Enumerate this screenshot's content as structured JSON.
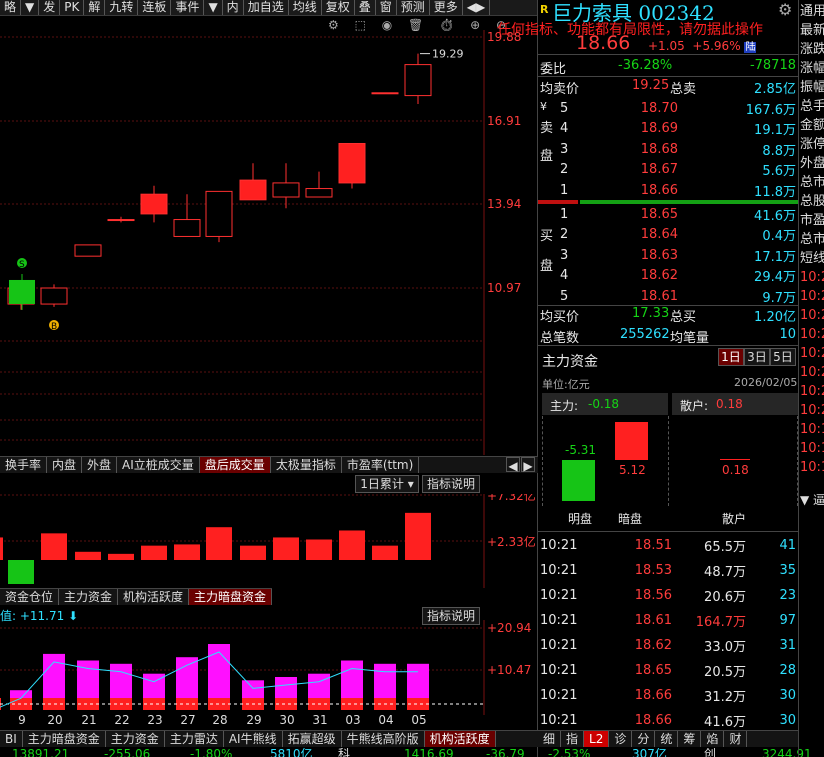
{
  "toolbar": {
    "items": [
      "略",
      "▼",
      "发",
      "PK",
      "解",
      "九转",
      "连板",
      "事件",
      "▼",
      "内",
      "加自选",
      "均线",
      "复权",
      "叠",
      "窗",
      "预测",
      "更多",
      "◀▶"
    ]
  },
  "chart_icons": "⚙ ⬚ ◉ 🗑 ⏱ ⊕ ⊖",
  "main_chart": {
    "price_labels": [
      "19.88",
      "16.91",
      "13.94",
      "10.97"
    ],
    "high_label": "19.29",
    "candles": [
      {
        "o": 10.97,
        "c": 10.4,
        "h": 11.2,
        "l": 10.2,
        "up": false
      },
      {
        "o": 10.4,
        "c": 10.97,
        "h": 11.1,
        "l": 10.3,
        "up": true
      },
      {
        "o": 12.1,
        "c": 12.5,
        "h": 12.5,
        "l": 12.1,
        "up": true
      },
      {
        "o": 13.4,
        "c": 13.4,
        "h": 13.5,
        "l": 13.3,
        "up": true
      },
      {
        "o": 13.6,
        "c": 14.3,
        "h": 14.6,
        "l": 13.3,
        "up": true
      },
      {
        "o": 12.8,
        "c": 13.4,
        "h": 14.3,
        "l": 12.8,
        "up": true
      },
      {
        "o": 12.8,
        "c": 14.4,
        "h": 14.4,
        "l": 12.6,
        "up": true
      },
      {
        "o": 14.1,
        "c": 14.8,
        "h": 15.4,
        "l": 14.1,
        "up": true
      },
      {
        "o": 14.2,
        "c": 14.7,
        "h": 15.4,
        "l": 13.8,
        "up": true
      },
      {
        "o": 14.2,
        "c": 14.5,
        "h": 15.1,
        "l": 14.2,
        "up": true
      },
      {
        "o": 14.7,
        "c": 16.1,
        "h": 16.1,
        "l": 14.5,
        "up": true
      },
      {
        "o": 17.9,
        "c": 17.9,
        "h": 17.9,
        "l": 17.9,
        "up": true
      },
      {
        "o": 17.8,
        "c": 18.9,
        "h": 19.29,
        "l": 17.5,
        "up": true
      }
    ],
    "markers": {
      "s": "S",
      "b": "B"
    }
  },
  "mid_tabs": [
    "换手率",
    "内盘",
    "外盘",
    "AI立桩成交量",
    "盘后成交量",
    "太极量指标",
    "市盈率(ttm)"
  ],
  "mid_select": "1日累计",
  "mid_help": "指标说明",
  "mid_axis": [
    "+7.32亿",
    "+2.33亿"
  ],
  "mid_bars": [
    0.55,
    0.3,
    0.65,
    0.2,
    0.15,
    0.35,
    0.38,
    0.8,
    0.35,
    0.55,
    0.5,
    0.72,
    0.35,
    1.15
  ],
  "low_tabs": [
    "资金仓位",
    "主力资金",
    "机构活跃度",
    "主力暗盘资金"
  ],
  "low_help": "指标说明",
  "low_value": "值: +11.71 ⬇",
  "low_axis": [
    "+20.94",
    "+10.47"
  ],
  "low_bars": [
    0.1,
    0.3,
    0.85,
    0.75,
    0.7,
    0.55,
    0.8,
    1.0,
    0.45,
    0.5,
    0.55,
    0.75,
    0.7,
    0.7
  ],
  "dates": [
    "9",
    "20",
    "21",
    "22",
    "23",
    "27",
    "28",
    "29",
    "30",
    "31",
    "03",
    "04",
    "05"
  ],
  "bottom_tabs": [
    "BI",
    "主力暗盘资金",
    "主力资金",
    "主力雷达",
    "AI牛熊线",
    "拓赢超级",
    "牛熊线高阶版",
    "机构活跃度"
  ],
  "bottom_ticker": [
    "13891.21",
    "-255.06",
    "-1.80%",
    "5810亿",
    "科",
    "1416.69",
    "-36.79",
    "-2.53%",
    "307亿",
    "创",
    "3244.91"
  ],
  "stock": {
    "name": "巨力索具",
    "code": "002342",
    "price": "18.66",
    "chg": "+1.05",
    "pct": "+5.96%",
    "tag": "陆"
  },
  "warning": "任何指标、功能都有局限性，请勿据此操作",
  "stats": {
    "weibi_label": "委比",
    "weibi": "-36.28%",
    "weicha": "-78718",
    "avg_sell_label": "均卖价",
    "avg_sell": "19.25",
    "total_sell_label": "总卖",
    "total_sell": "2.85亿",
    "avg_buy_label": "均买价",
    "avg_buy": "17.33",
    "total_buy_label": "总买",
    "total_buy": "1.20亿",
    "bills_label": "总笔数",
    "bills": "255262",
    "avg_vol_label": "均笔量",
    "avg_vol": "10"
  },
  "sell": [
    {
      "n": "5",
      "p": "18.70",
      "v": "167.6万"
    },
    {
      "n": "4",
      "p": "18.69",
      "v": "19.1万"
    },
    {
      "n": "3",
      "p": "18.68",
      "v": "8.8万"
    },
    {
      "n": "2",
      "p": "18.67",
      "v": "5.6万"
    },
    {
      "n": "1",
      "p": "18.66",
      "v": "11.8万"
    }
  ],
  "buy": [
    {
      "n": "1",
      "p": "18.65",
      "v": "41.6万"
    },
    {
      "n": "2",
      "p": "18.64",
      "v": "0.4万"
    },
    {
      "n": "3",
      "p": "18.63",
      "v": "17.1万"
    },
    {
      "n": "4",
      "p": "18.62",
      "v": "29.4万"
    },
    {
      "n": "5",
      "p": "18.61",
      "v": "9.7万"
    }
  ],
  "sell_side_label": [
    "¥",
    "卖",
    "盘"
  ],
  "buy_side_label": [
    "买",
    "盘"
  ],
  "fund": {
    "title": "主力资金",
    "tabs": [
      "1日",
      "3日",
      "5日"
    ],
    "unit": "单位:亿元",
    "date": "2026/02/05",
    "main_label": "主力:",
    "main_val": "-0.18",
    "retail_label": "散户:",
    "retail_val": "0.18",
    "bar1": "-5.31",
    "bar2": "5.12",
    "bar3": "0.18",
    "legend": [
      "明盘",
      "暗盘",
      "散户"
    ]
  },
  "ticks": [
    {
      "t": "10:21",
      "p": "18.51",
      "v": "65.5万",
      "c": "41"
    },
    {
      "t": "10:21",
      "p": "18.53",
      "v": "48.7万",
      "c": "35"
    },
    {
      "t": "10:21",
      "p": "18.56",
      "v": "20.6万",
      "c": "23"
    },
    {
      "t": "10:21",
      "p": "18.61",
      "v": "164.7万",
      "c": "97"
    },
    {
      "t": "10:21",
      "p": "18.62",
      "v": "33.0万",
      "c": "31"
    },
    {
      "t": "10:21",
      "p": "18.65",
      "v": "20.5万",
      "c": "28"
    },
    {
      "t": "10:21",
      "p": "18.66",
      "v": "31.2万",
      "c": "30"
    },
    {
      "t": "10:21",
      "p": "18.66",
      "v": "41.6万",
      "c": "30"
    }
  ],
  "bottom_right_tabs": [
    "细",
    "指",
    "L2",
    "诊",
    "分",
    "统",
    "筹",
    "焰",
    "财"
  ],
  "rightmost": [
    "通用",
    "最新",
    "涨跌",
    "涨幅",
    "振幅",
    "总手",
    "金额",
    "涨停",
    "外盘",
    "总市",
    "总股",
    "市盈",
    "总市",
    "短线",
    "10:2",
    "10:2",
    "10:2",
    "10:2",
    "10:2",
    "10:2",
    "10:2",
    "10:2",
    "10:1",
    "10:1",
    "10:1"
  ],
  "rightmost_label": "R",
  "rightmost_bottom": "▼ 逼"
}
